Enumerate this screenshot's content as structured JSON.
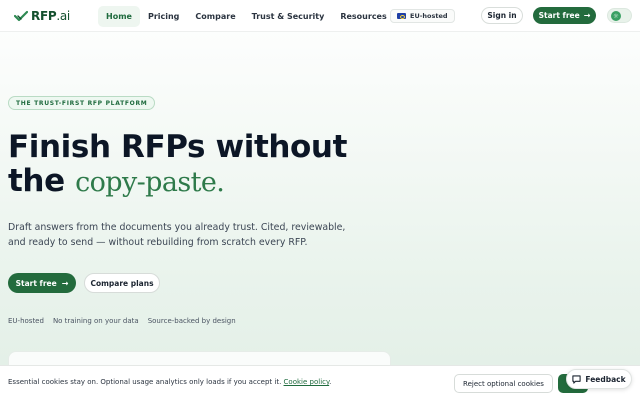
{
  "brand": {
    "name": "RFP",
    "suffix": ".ai",
    "icon": "logo-checkmark-icon",
    "color": "#14502e"
  },
  "nav": {
    "links": [
      {
        "label": "Home",
        "active": true
      },
      {
        "label": "Pricing",
        "active": false
      },
      {
        "label": "Compare",
        "active": false
      },
      {
        "label": "Trust & Security",
        "active": false
      },
      {
        "label": "Resources",
        "active": false
      }
    ],
    "eu_badge": "EU-hosted",
    "eu_icon": "eu-flag-icon",
    "sign_in": "Sign in",
    "start_free": "Start free",
    "start_free_icon": "arrow-right-icon",
    "theme_toggle_icon": "theme-toggle-icon"
  },
  "hero": {
    "badge": "THE TRUST-FIRST RFP PLATFORM",
    "headline_line1": "Finish RFPs without",
    "headline_line2_plain": "the",
    "headline_line2_accent": "copy-paste.",
    "subtext": "Draft answers from the documents you already trust. Cited, reviewable, and ready to send — without rebuilding from scratch every RFP.",
    "cta_primary": "Start free",
    "cta_primary_icon": "arrow-right-icon",
    "cta_secondary": "Compare plans",
    "trust_items": [
      "EU-hosted",
      "No training on your data",
      "Source-backed by design"
    ]
  },
  "cookie": {
    "text": "Essential cookies stay on. Optional usage analytics only loads if you accept it.",
    "link": "Cookie policy",
    "trailing": ".",
    "reject": "Reject optional cookies"
  },
  "feedback": {
    "label": "Feedback",
    "icon": "feedback-icon"
  },
  "colors": {
    "accent": "#236b3d",
    "accent_light": "#eef8f1",
    "text": "#0c1626",
    "serif_accent": "#2e7a4a"
  }
}
